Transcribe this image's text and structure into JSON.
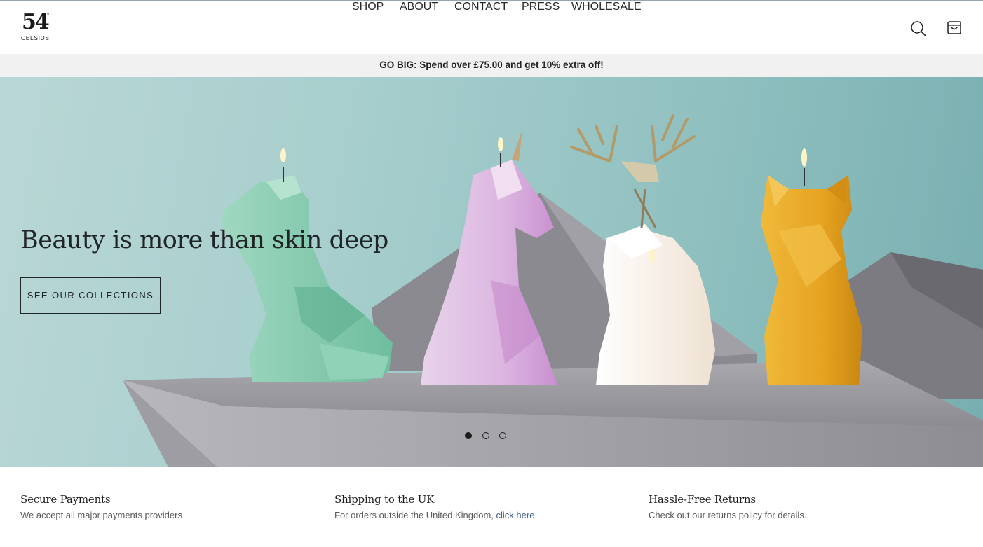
{
  "brand": {
    "logo_number": "54",
    "logo_degree": "°",
    "logo_sub": "CELSIUS"
  },
  "nav": {
    "items": [
      {
        "label": "SHOP"
      },
      {
        "label": "ABOUT"
      },
      {
        "label": "CONTACT"
      },
      {
        "label": "PRESS"
      },
      {
        "label": "WHOLESALE"
      }
    ]
  },
  "header_icons": {
    "search": "search-icon",
    "cart": "cart-icon"
  },
  "promo": {
    "text": "GO BIG: Spend over £75.00 and get 10% extra off!"
  },
  "hero": {
    "title": "Beauty is more than skin deep",
    "cta_label": "SEE OUR COLLECTIONS",
    "slides_total": 3,
    "active_slide": 1
  },
  "features": [
    {
      "title": "Secure Payments",
      "text": "We accept all major payments providers"
    },
    {
      "title": "Shipping to the UK",
      "text": "For orders outside the United Kingdom, ",
      "link": "click here",
      "text_after": "."
    },
    {
      "title": "Hassle-Free Returns",
      "text": "Check out our returns policy for details."
    }
  ],
  "colors": {
    "hero_bg": "#a7cecd",
    "promo_bg": "#f1f1f1",
    "link": "#3d5f89",
    "text_dark": "#1f2426"
  }
}
